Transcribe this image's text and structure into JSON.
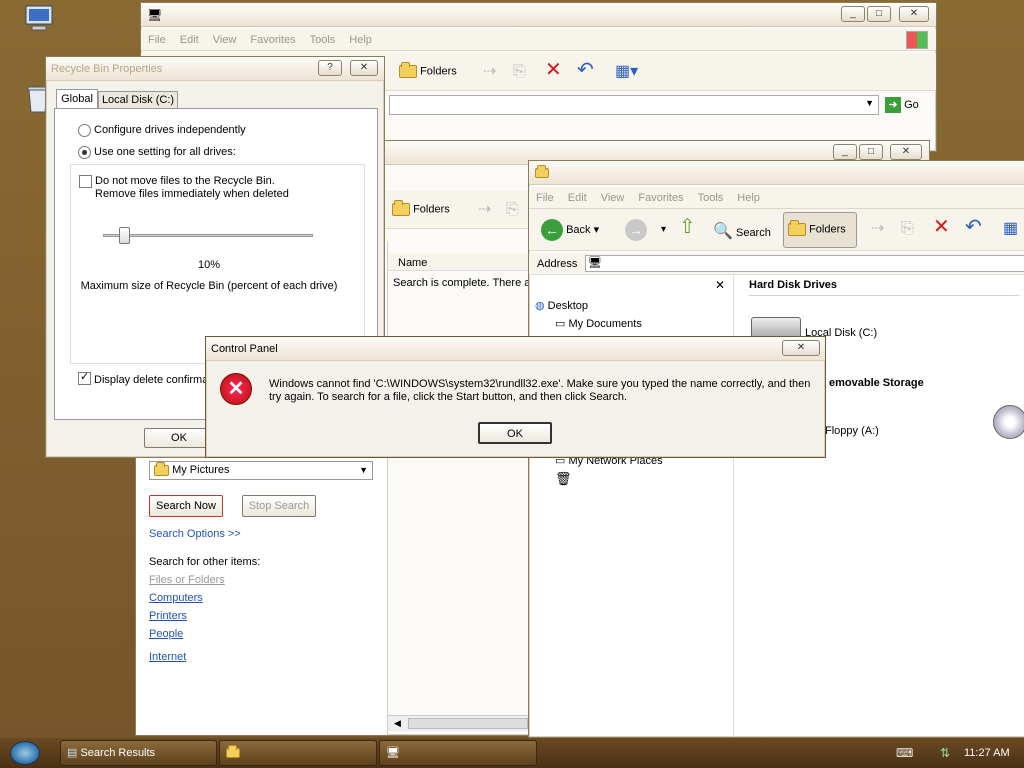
{
  "colors": {
    "accent": "#2252b8",
    "error": "#d11c1c",
    "desktop": "#7a5a2c"
  },
  "explorer_back": {
    "menu": [
      "File",
      "Edit",
      "View",
      "Favorites",
      "Tools",
      "Help"
    ],
    "folders_label": "Folders",
    "go_label": "Go"
  },
  "recycle": {
    "title": "Recycle Bin Properties",
    "tabs": [
      "Global",
      "Local Disk (C:)"
    ],
    "opt_independent": "Configure drives independently",
    "opt_one": "Use one setting for all drives:",
    "no_move_1": "Do not move files to the Recycle Bin.",
    "no_move_2": "Remove files immediately when deleted",
    "percent": "10%",
    "percent_value": 0.1,
    "max_size_label": "Maximum size of Recycle Bin (percent of each drive)",
    "confirm_label": "Display delete confirmation dialog",
    "ok": "OK"
  },
  "search": {
    "folders_label": "Folders",
    "column_name": "Name",
    "status": "Search is complete. There a",
    "look_in": "My Pictures",
    "search_now": "Search Now",
    "stop_search": "Stop Search",
    "search_options": "Search Options >>",
    "other_items": "Search for other items:",
    "links": [
      "Files or Folders",
      "Computers",
      "Printers",
      "People"
    ],
    "internet": "Internet"
  },
  "mycomputer": {
    "menu": [
      "File",
      "Edit",
      "View",
      "Favorites",
      "Tools",
      "Help"
    ],
    "back": "Back",
    "search": "Search",
    "folders": "Folders",
    "address_label": "Address",
    "tree": [
      "Desktop",
      "My Documents",
      "My Network Places"
    ],
    "hdd_header": "Hard Disk Drives",
    "local_disk": "Local Disk (C:)",
    "removable_header": "emovable Storage",
    "floppy": "Floppy (A:)"
  },
  "dialog": {
    "title": "Control Panel",
    "message": "Windows cannot find 'C:\\WINDOWS\\system32\\rundll32.exe'. Make sure you typed the name correctly, and then try again. To search for a file, click the Start button, and then click Search.",
    "ok": "OK"
  },
  "taskbar": {
    "items": [
      "Search Results"
    ],
    "clock": "11:27 AM"
  }
}
